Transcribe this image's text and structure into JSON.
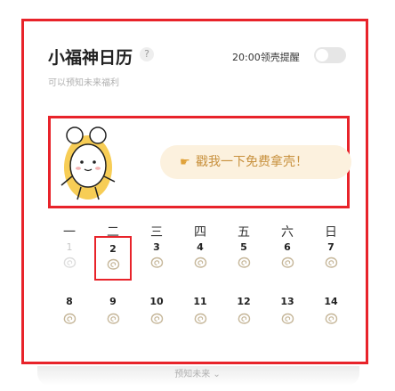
{
  "header": {
    "title": "小福神日历",
    "help_icon": "?",
    "subtitle": "可以预知未来福利",
    "reminder_label": "20:00领壳提醒",
    "reminder_enabled": false
  },
  "banner": {
    "cta_label": "戳我一下免费拿壳！",
    "cta_icon": "pointing-hand-icon"
  },
  "calendar": {
    "weekdays": [
      "一",
      "二",
      "三",
      "四",
      "五",
      "六",
      "日"
    ],
    "week1": [
      {
        "num": "1",
        "state": "past"
      },
      {
        "num": "2",
        "state": "today"
      },
      {
        "num": "3",
        "state": "future"
      },
      {
        "num": "4",
        "state": "future"
      },
      {
        "num": "5",
        "state": "future"
      },
      {
        "num": "6",
        "state": "future"
      },
      {
        "num": "7",
        "state": "future"
      }
    ],
    "week2": [
      {
        "num": "8",
        "state": "future"
      },
      {
        "num": "9",
        "state": "future"
      },
      {
        "num": "10",
        "state": "future"
      },
      {
        "num": "11",
        "state": "future"
      },
      {
        "num": "12",
        "state": "future"
      },
      {
        "num": "13",
        "state": "future"
      },
      {
        "num": "14",
        "state": "future"
      }
    ],
    "more_label": "预知未来"
  },
  "colors": {
    "highlight": "#e8232a",
    "shell_active": "#c6b79a",
    "shell_past": "#dddddd",
    "cta_text": "#c8913e",
    "cta_bg": "#fcf1de"
  }
}
